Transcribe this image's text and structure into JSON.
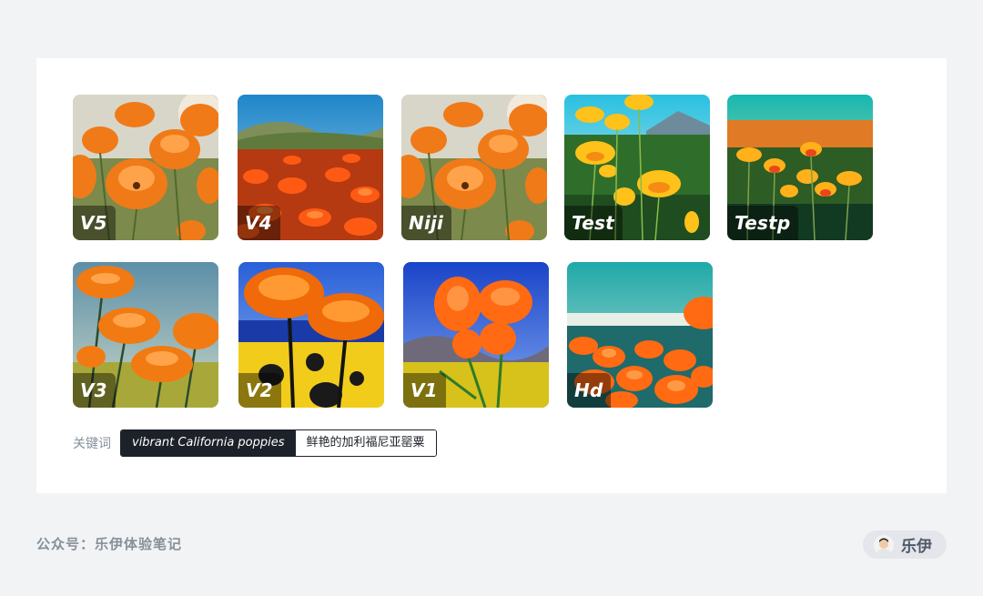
{
  "gallery": {
    "items": [
      {
        "label": "V5"
      },
      {
        "label": "V4"
      },
      {
        "label": "Niji"
      },
      {
        "label": "Test"
      },
      {
        "label": "Testp"
      },
      {
        "label": "V3"
      },
      {
        "label": "V2"
      },
      {
        "label": "V1"
      },
      {
        "label": "Hd"
      }
    ]
  },
  "keywords": {
    "label": "关键词",
    "english": "vibrant California poppies",
    "chinese": "鲜艳的加利福尼亚罂粟"
  },
  "footer": {
    "account": "公众号：乐伊体验笔记",
    "author": "乐伊"
  },
  "colors": {
    "page_bg": "#f2f3f5",
    "card_bg": "#ffffff",
    "poppy_orange": "#ff7a1a",
    "dark_pill": "#1d2129"
  }
}
